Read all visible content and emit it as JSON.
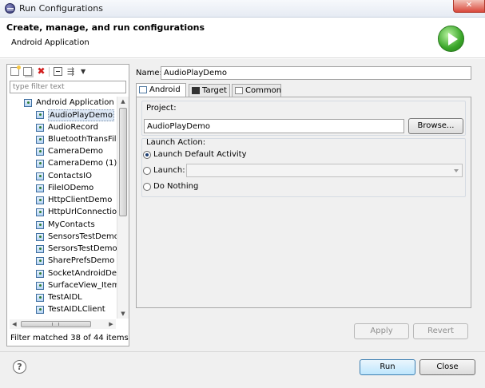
{
  "window": {
    "title": "Run Configurations",
    "close_glyph": "✕",
    "app_icon": "eclipse-icon"
  },
  "header": {
    "title": "Create, manage, and run configurations",
    "subtitle": "Android Application",
    "icon": "run-icon"
  },
  "sidebar": {
    "toolbar_icons": [
      "new-configuration-icon",
      "duplicate-icon",
      "delete-icon",
      "collapse-all-icon",
      "filter-icon",
      "view-menu-icon"
    ],
    "filter_placeholder": "type filter text",
    "group_label": "Android Application",
    "items": [
      {
        "label": "AudioPlayDemo"
      },
      {
        "label": "AudioRecord"
      },
      {
        "label": "BluetoothTransFile"
      },
      {
        "label": "CameraDemo"
      },
      {
        "label": "CameraDemo (1)"
      },
      {
        "label": "ContactsIO"
      },
      {
        "label": "FileIODemo"
      },
      {
        "label": "HttpClientDemo"
      },
      {
        "label": "HttpUrlConnectionD"
      },
      {
        "label": "MyContacts"
      },
      {
        "label": "SensorsTestDemo"
      },
      {
        "label": "SersorsTestDemo"
      },
      {
        "label": "SharePrefsDemo"
      },
      {
        "label": "SocketAndroidDem"
      },
      {
        "label": "SurfaceView_Item"
      },
      {
        "label": "TestAIDL"
      },
      {
        "label": "TestAIDLClient"
      }
    ],
    "selected_item": "AudioPlayDemo",
    "status": "Filter matched 38 of 44 items"
  },
  "config": {
    "name_label": "Name:",
    "name_value": "AudioPlayDemo",
    "tabs": [
      {
        "label": "Android",
        "icon": "android-tab-icon",
        "active": true
      },
      {
        "label": "Target",
        "icon": "target-tab-icon",
        "active": false
      },
      {
        "label": "Common",
        "icon": "common-tab-icon",
        "active": false
      }
    ],
    "project_label": "Project:",
    "project_value": "AudioPlayDemo",
    "browse_label": "Browse...",
    "launch_action_label": "Launch Action:",
    "options": [
      {
        "label": "Launch Default Activity",
        "checked": true
      },
      {
        "label": "Launch:",
        "checked": false
      },
      {
        "label": "Do Nothing",
        "checked": false
      }
    ],
    "launch_select_value": ""
  },
  "buttons": {
    "apply": "Apply",
    "revert": "Revert",
    "run": "Run",
    "close": "Close",
    "help": "?"
  }
}
